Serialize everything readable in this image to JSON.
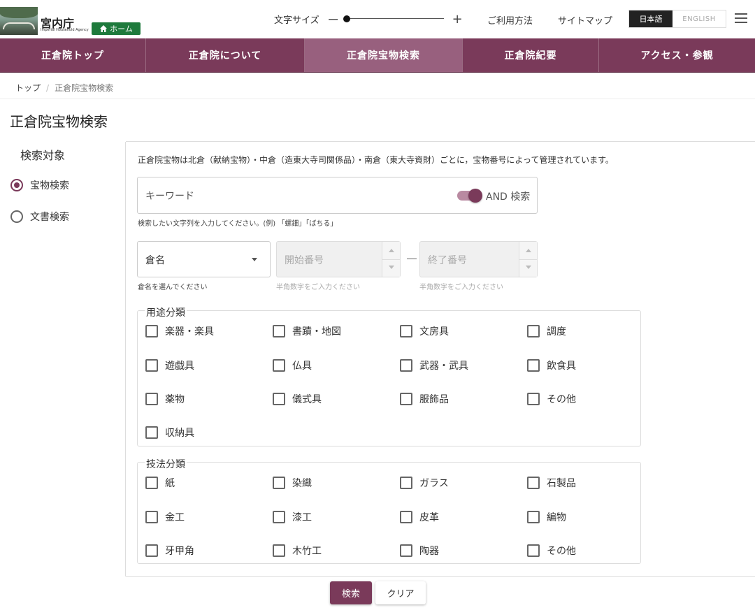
{
  "header": {
    "logo_title": "宮内庁",
    "logo_subtitle": "Imperial Household Agency",
    "home_label": "ホーム",
    "font_size_label": "文字サイズ",
    "font_size_minus": "ー",
    "font_size_plus": "+",
    "usage_link": "ご利用方法",
    "sitemap_link": "サイトマップ",
    "lang_ja": "日本語",
    "lang_en": "ENGLISH"
  },
  "nav": {
    "items": [
      {
        "label": "正倉院トップ"
      },
      {
        "label": "正倉院について"
      },
      {
        "label": "正倉院宝物検索"
      },
      {
        "label": "正倉院紀要"
      },
      {
        "label": "アクセス・参観"
      }
    ]
  },
  "breadcrumb": {
    "top": "トップ",
    "separator": "/",
    "current": "正倉院宝物検索"
  },
  "page_title": "正倉院宝物検索",
  "sidebar": {
    "title": "検索対象",
    "options": [
      {
        "label": "宝物検索",
        "selected": true
      },
      {
        "label": "文書検索",
        "selected": false
      }
    ]
  },
  "main": {
    "intro": "正倉院宝物は北倉（献納宝物）・中倉（造東大寺司関係品）・南倉（東大寺資財）ごとに，宝物番号によって管理されています。",
    "keyword_placeholder": "キーワード",
    "and_toggle_label": "AND 検索",
    "keyword_help": "検索したい文字列を入力してください。(例) 「螺鈿」「ばちる」",
    "storehouse_label": "倉名",
    "storehouse_help": "倉名を選んでください",
    "start_placeholder": "開始番号",
    "start_help": "半角数字をご入力ください",
    "end_placeholder": "終了番号",
    "end_help": "半角数字をご入力ください",
    "usage_title": "用途分類",
    "usage_items": [
      "楽器・楽具",
      "書蹟・地図",
      "文房具",
      "調度",
      "遊戯具",
      "仏具",
      "武器・武具",
      "飲食具",
      "薬物",
      "儀式具",
      "服飾品",
      "その他",
      "収納具"
    ],
    "technique_title": "技法分類",
    "technique_items": [
      "紙",
      "染織",
      "ガラス",
      "石製品",
      "金工",
      "漆工",
      "皮革",
      "編物",
      "牙甲角",
      "木竹工",
      "陶器",
      "その他"
    ],
    "search_button": "検索",
    "clear_button": "クリア"
  },
  "colors": {
    "brand": "#7a3a5a",
    "home_green": "#1e7a3c"
  }
}
